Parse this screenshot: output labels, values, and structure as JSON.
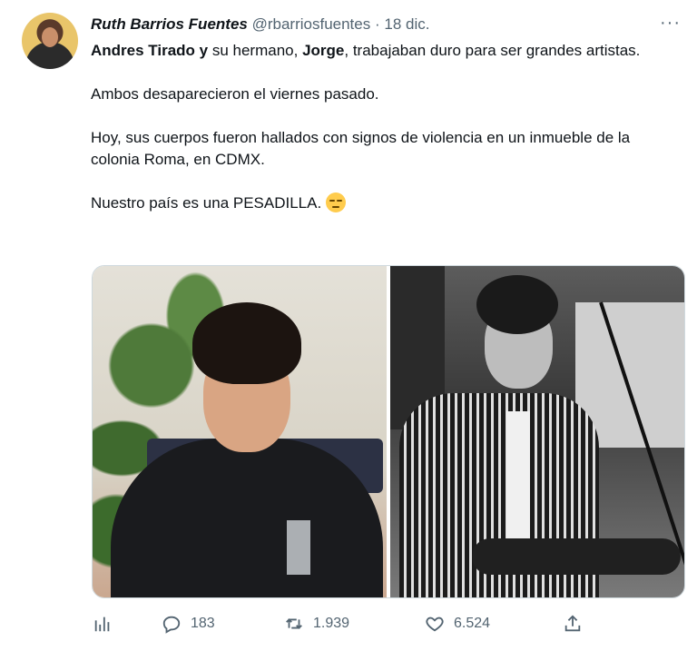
{
  "tweet": {
    "author_name": "Ruth Barrios Fuentes",
    "author_handle": "@rbarriosfuentes",
    "separator": "·",
    "date": "18 dic.",
    "more_label": "···",
    "lines": {
      "p1_bold1": "Andres Tirado y",
      "p1_text1": " su hermano, ",
      "p1_bold2": "Jorge",
      "p1_text2": ", trabajaban duro para ser grandes artistas.",
      "p2": "Ambos desaparecieron el viernes pasado.",
      "p3": "Hoy, sus cuerpos fueron hallados con signos de violencia en un inmueble de la colonia Roma, en CDMX.",
      "p4": "Nuestro país es una PESADILLA. "
    },
    "emoji": "pensive-face-emoji",
    "stats": {
      "replies": "183",
      "retweets": "1.939",
      "likes": "6.524"
    },
    "icons": {
      "analytics": "analytics-icon",
      "reply": "reply-icon",
      "retweet": "retweet-icon",
      "like": "heart-icon",
      "share": "share-icon"
    },
    "colors": {
      "text": "#0f1419",
      "secondary": "#536471",
      "border": "#cfd9de"
    }
  }
}
